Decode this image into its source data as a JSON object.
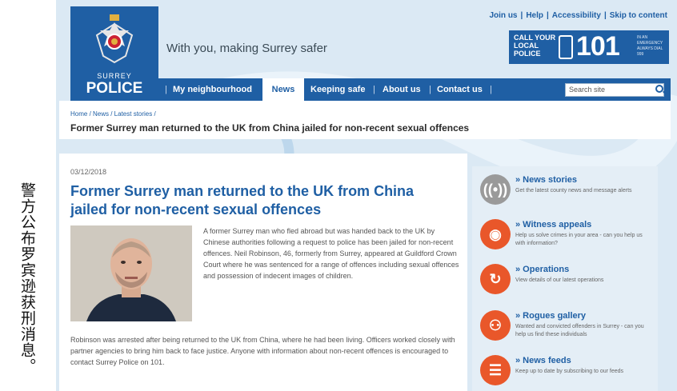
{
  "caption": "警方公布罗宾逊获刑消息。",
  "header": {
    "logo_top": "SURREY",
    "logo_bottom": "POLICE",
    "tagline": "With you, making Surrey safer",
    "utility_links": [
      "Join us",
      "Help",
      "Accessibility",
      "Skip to content"
    ],
    "call_text": "CALL YOUR LOCAL POLICE",
    "call_number": "101",
    "call_small": "IN AN EMERGENCY ALWAYS DIAL 999"
  },
  "nav": {
    "items": [
      "My neighbourhood",
      "News",
      "Keeping safe",
      "About us",
      "Contact us"
    ],
    "active": "News",
    "search_placeholder": "Search site"
  },
  "breadcrumb": {
    "path": "Home / News / Latest stories /",
    "current": "Former Surrey man returned to the UK from China jailed for non-recent sexual offences"
  },
  "article": {
    "date": "03/12/2018",
    "title": "Former Surrey man returned to the UK from China jailed for non-recent sexual offences",
    "para1": "A former Surrey man who fled abroad but was handed back to the UK by Chinese authorities following a request to police has been jailed for non-recent offences. Neil Robinson, 46, formerly from Surrey, appeared at Guildford Crown Court where he was sentenced for a range of offences including sexual offences and possession of indecent images of children.",
    "para2": "Robinson was arrested after being returned to the UK from China, where he had been living. Officers worked closely with partner agencies to bring him back to face justice. Anyone with information about non-recent offences is encouraged to contact Surrey Police on 101."
  },
  "sidebar": [
    {
      "icon": "radio-waves-icon",
      "title": "» News stories",
      "desc": "Get the latest county news and message alerts",
      "color": "#9a9a9a"
    },
    {
      "icon": "eye-icon",
      "title": "» Witness appeals",
      "desc": "Help us solve crimes in your area - can you help us with information?",
      "color": "#e9572a"
    },
    {
      "icon": "arrows-icon",
      "title": "» Operations",
      "desc": "View details of our latest operations",
      "color": "#e9572a"
    },
    {
      "icon": "people-icon",
      "title": "» Rogues gallery",
      "desc": "Wanted and convicted offenders in Surrey - can you help us find these individuals",
      "color": "#e9572a"
    },
    {
      "icon": "rss-icon",
      "title": "» News feeds",
      "desc": "Keep up to date by subscribing to our feeds",
      "color": "#e9572a"
    }
  ]
}
